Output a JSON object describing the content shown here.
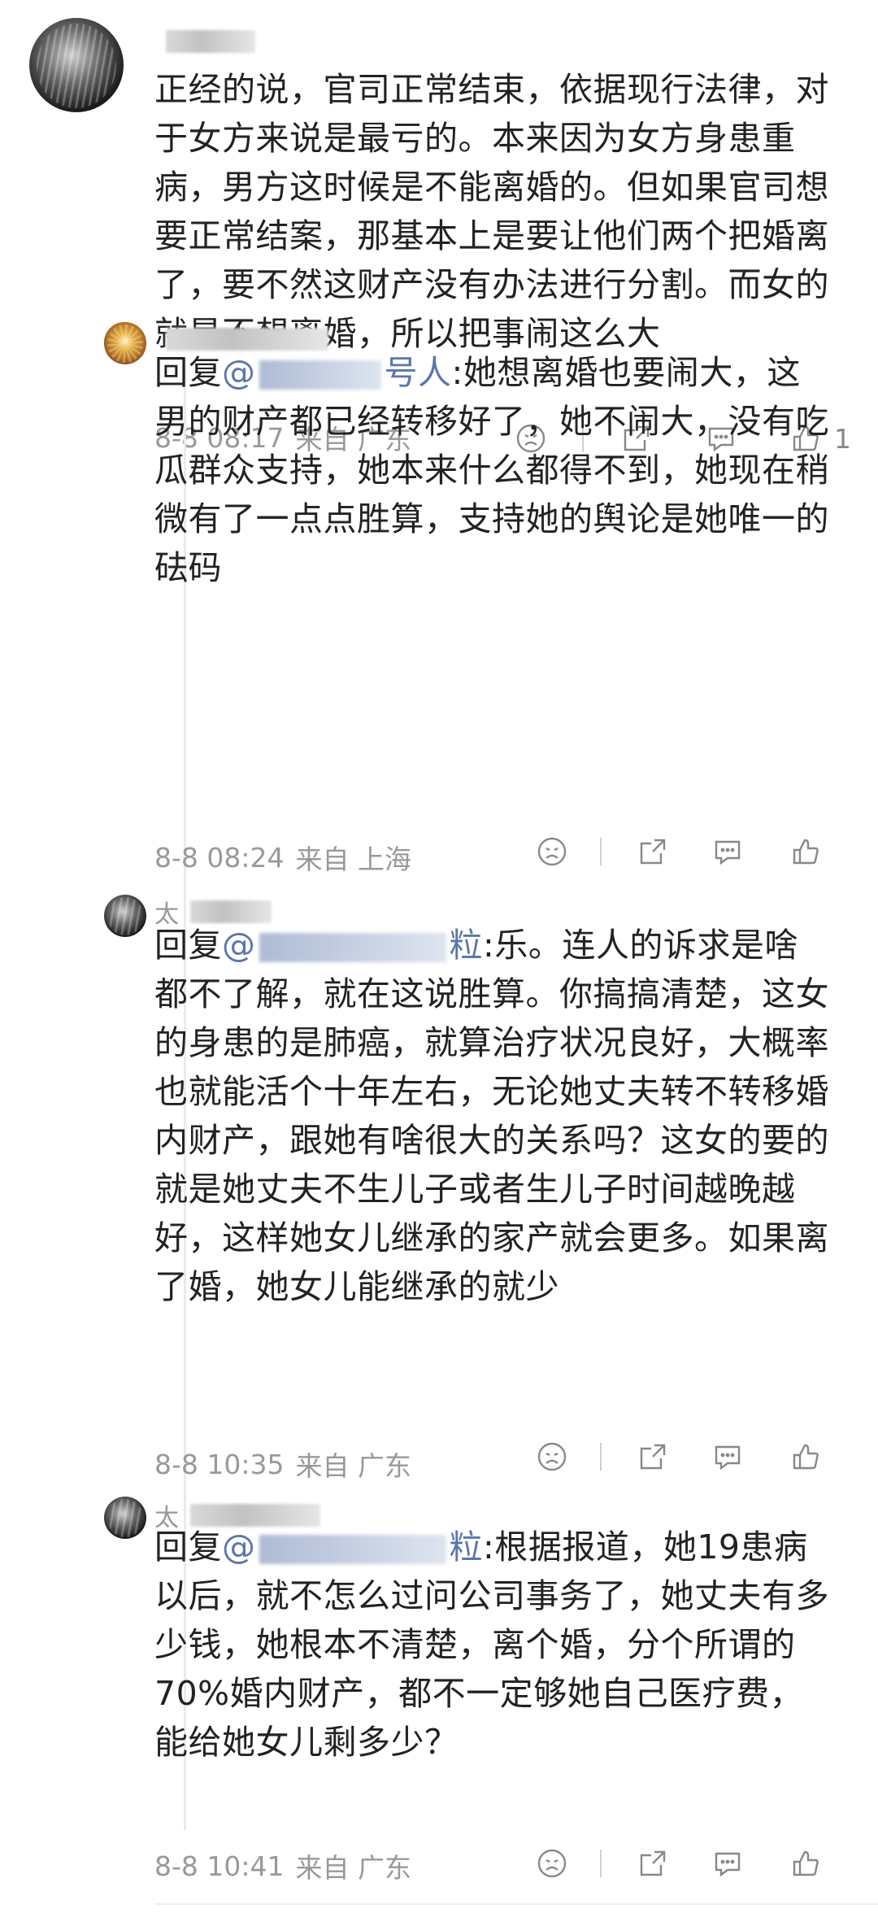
{
  "main_comment": {
    "author_initial": "",
    "text": "正经的说，官司正常结束，依据现行法律，对于女方来说是最亏的。本来因为女方身患重病，男方这时候是不能离婚的。但如果官司想要正常结案，那基本上是要让他们两个把婚离了，要不然这财产没有办法进行分割。而女的就是不想离婚，所以把事闹这么大",
    "time": "8-8 08:17",
    "source": "来自 广东",
    "like_count": "1"
  },
  "replies": [
    {
      "author_initial": "",
      "reply_prefix": "回复",
      "mention_start": "@",
      "mention_end": "号人",
      "text": ":她想离婚也要闹大，这男的财产都已经转移好了，她不闹大，没有吃瓜群众支持，她本来什么都得不到，她现在稍微有了一点点胜算，支持她的舆论是她唯一的砝码",
      "time": "8-8 08:24",
      "source": "来自 上海"
    },
    {
      "author_initial": "太",
      "reply_prefix": "回复",
      "mention_start": "@",
      "mention_end": "粒",
      "text": ":乐。连人的诉求是啥都不了解，就在这说胜算。你搞搞清楚，这女的身患的是肺癌，就算治疗状况良好，大概率也就能活个十年左右，无论她丈夫转不转移婚内财产，跟她有啥很大的关系吗？这女的要的就是她丈夫不生儿子或者生儿子时间越晚越好，这样她女儿继承的家产就会更多。如果离了婚，她女儿能继承的就少",
      "time": "8-8 10:35",
      "source": "来自 广东"
    },
    {
      "author_initial": "太",
      "reply_prefix": "回复",
      "mention_start": "@",
      "mention_end": "粒",
      "text": ":根据报道，她19患病以后，就不怎么过问公司事务了，她丈夫有多少钱，她根本不清楚，离个婚，分个所谓的70%婚内财产，都不一定够她自己医疗费，能给她女儿剩多少？",
      "time": "8-8 10:41",
      "source": "来自 广东"
    }
  ],
  "icons": {
    "emoji": "emoji-icon",
    "share": "share-icon",
    "comment": "comment-icon",
    "like": "thumbs-up-icon"
  },
  "colors": {
    "text": "#222222",
    "meta": "#999999",
    "mention": "#5b77a8"
  }
}
